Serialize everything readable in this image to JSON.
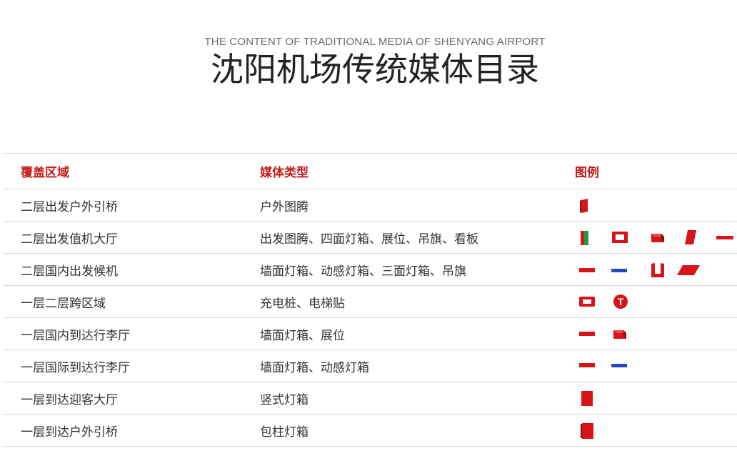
{
  "header": {
    "subtitle": "THE CONTENT OF TRADITIONAL MEDIA OF SHENYANG AIRPORT",
    "title": "沈阳机场传统媒体目录"
  },
  "table": {
    "columns": [
      "覆盖区域",
      "媒体类型",
      "图例"
    ],
    "rows": [
      {
        "area": "二层出发户外引桥",
        "media": "户外图腾",
        "legend": [
          "totem-icon"
        ]
      },
      {
        "area": "二层出发值机大厅",
        "media": "出发图腾、四面灯箱、展位、吊旗、看板",
        "legend": [
          "totem-icon",
          "four-sided-lightbox-icon",
          "booth-icon",
          "hanging-flag-icon",
          "billboard-icon"
        ]
      },
      {
        "area": "二层国内出发候机",
        "media": "墙面灯箱、动感灯箱、三面灯箱、吊旗",
        "legend": [
          "wall-lightbox-icon",
          "dynamic-lightbox-icon",
          "three-sided-lightbox-icon",
          "hanging-flag-icon"
        ]
      },
      {
        "area": "一层二层跨区域",
        "media": "充电桩、电梯贴",
        "legend": [
          "charging-pile-icon",
          "elevator-sticker-icon"
        ]
      },
      {
        "area": "一层国内到达行李厅",
        "media": "墙面灯箱、展位",
        "legend": [
          "wall-lightbox-icon",
          "booth-icon"
        ]
      },
      {
        "area": "一层国际到达行李厅",
        "media": "墙面灯箱、动感灯箱",
        "legend": [
          "wall-lightbox-icon",
          "dynamic-lightbox-icon"
        ]
      },
      {
        "area": "一层到达迎客大厅",
        "media": "竖式灯箱",
        "legend": [
          "vertical-lightbox-icon"
        ]
      },
      {
        "area": "一层到达户外引桥",
        "media": "包柱灯箱",
        "legend": [
          "column-lightbox-icon"
        ]
      }
    ]
  },
  "colors": {
    "accent_red": "#d7141a",
    "legend_blue": "#2b44c4",
    "legend_green": "#1f9a3a",
    "header_red": "#c41a1a"
  },
  "legend_icons": {
    "elevator_sticker_letter": "T"
  }
}
